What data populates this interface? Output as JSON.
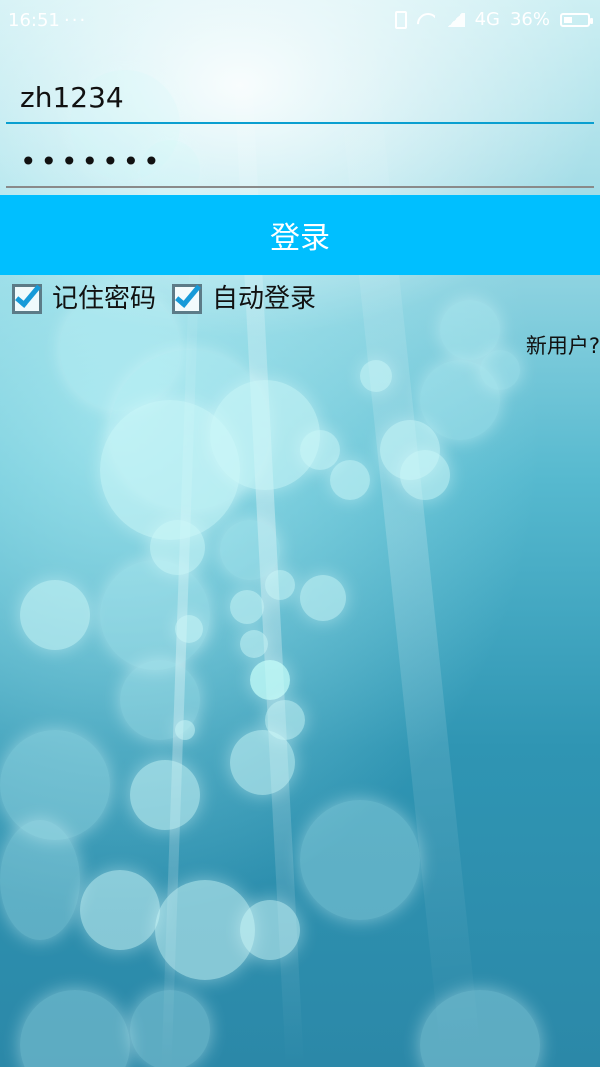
{
  "status_bar": {
    "time": "16:51",
    "dots": "···",
    "network": "4G",
    "battery": "36%",
    "battery_level": 0.36,
    "icons": [
      "vibrate-icon",
      "wifi-icon",
      "signal-icon",
      "battery-icon"
    ]
  },
  "login_form": {
    "username_value": "zh1234",
    "password_value": "•••••••",
    "login_button": "登录",
    "remember_password": {
      "label": "记住密码",
      "checked": true
    },
    "auto_login": {
      "label": "自动登录",
      "checked": true
    },
    "new_user_link": "新用户?"
  },
  "colors": {
    "accent": "#00bfff",
    "active_underline": "#0a9fd0",
    "check": "#169ad8"
  }
}
